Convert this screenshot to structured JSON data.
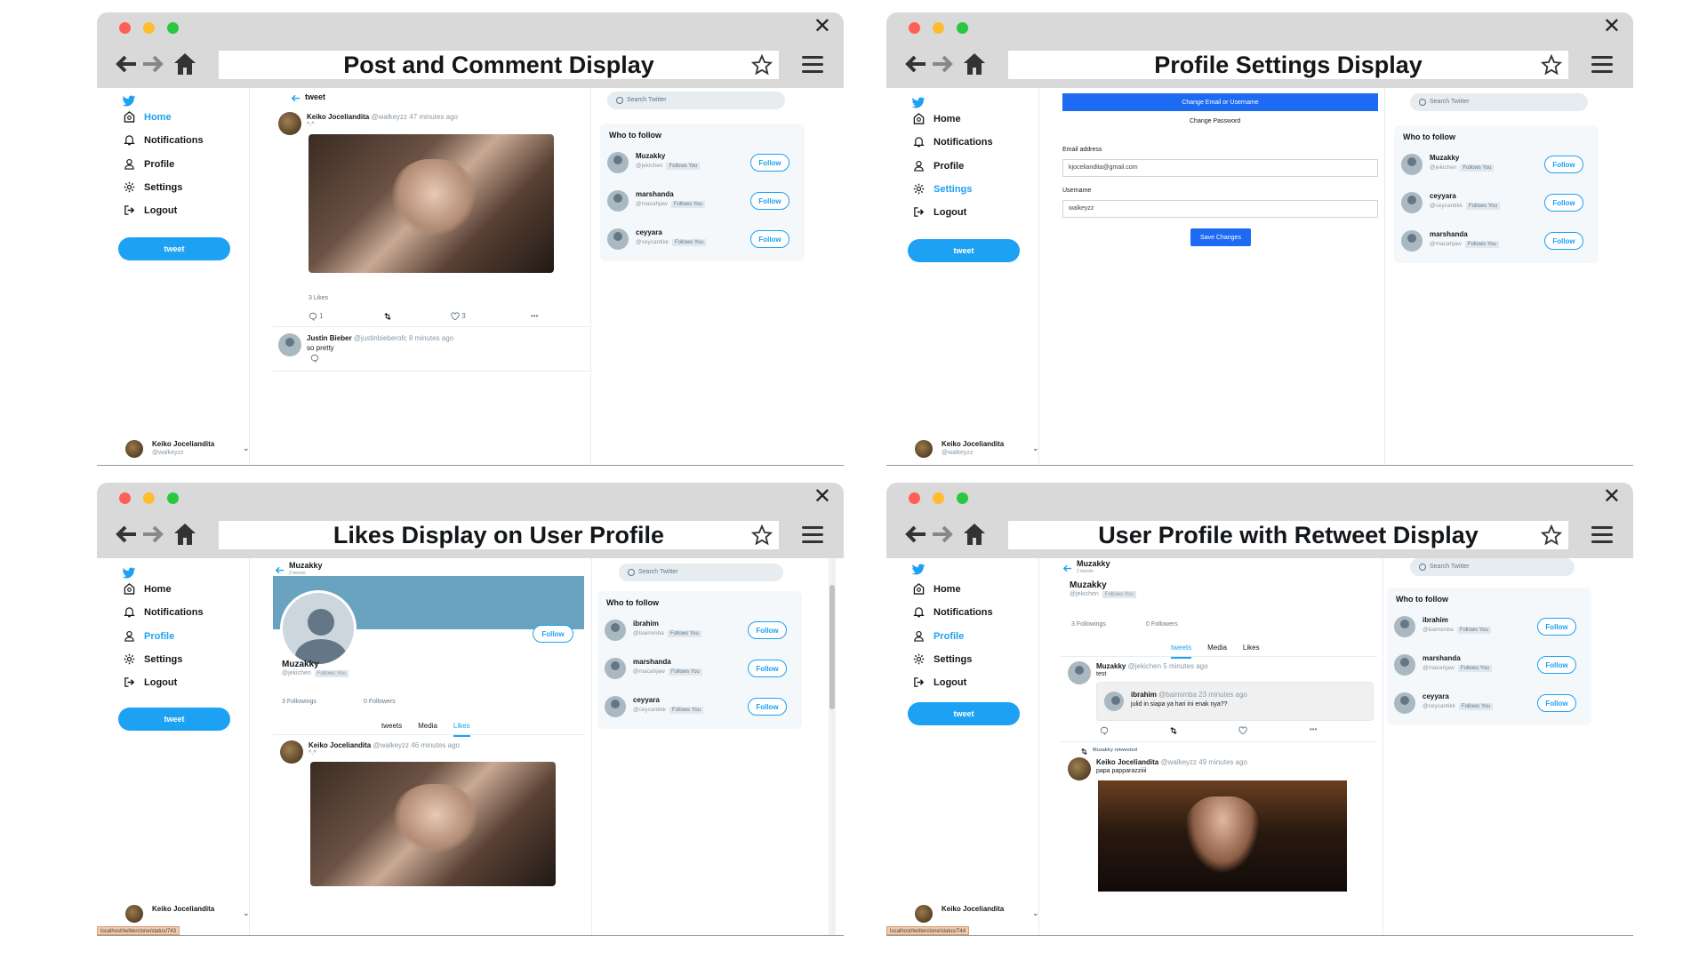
{
  "windows": [
    {
      "title": "Post and Comment Display"
    },
    {
      "title": "Profile Settings Display"
    },
    {
      "title": "Likes Display on User Profile"
    },
    {
      "title": "User Profile with Retweet Display"
    }
  ],
  "nav": {
    "home": "Home",
    "notifications": "Notifications",
    "profile": "Profile",
    "settings": "Settings",
    "logout": "Logout",
    "tweet_button": "tweet"
  },
  "account": {
    "name": "Keiko Joceliandita",
    "handle": "@walkeyzz"
  },
  "search_placeholder": "Search Twitter",
  "who_to_follow": "Who to follow",
  "follow_label": "Follow",
  "follows_you": "Follows You",
  "w1": {
    "header": "tweet",
    "post_author": "Keiko Joceliandita",
    "post_meta": "@walkeyzz 47 minutes ago",
    "post_text": "^.^",
    "likes": "3 Likes",
    "reply_count": "1",
    "like_count": "3",
    "more": "•••",
    "comment_author": "Justin Bieber",
    "comment_meta": "@justinbieberofc 8 minutes ago",
    "comment_text": "so pretty",
    "follow": [
      {
        "name": "Muzakky",
        "handle": "@jekichen"
      },
      {
        "name": "marshanda",
        "handle": "@macahjaw"
      },
      {
        "name": "ceyyara",
        "handle": "@ceycantikk"
      }
    ]
  },
  "w2": {
    "change_email_btn": "Change Email or Username",
    "change_password": "Change Password",
    "email_label": "Email address",
    "email_value": "kjoceliandita@gmail.com",
    "username_label": "Username",
    "username_value": "walkeyzz",
    "save_btn": "Save Changes",
    "follow": [
      {
        "name": "Muzakky",
        "handle": "@jekichen"
      },
      {
        "name": "ceyyara",
        "handle": "@ceycantikk"
      },
      {
        "name": "marshanda",
        "handle": "@macahjaw"
      }
    ]
  },
  "w3": {
    "profile_name": "Muzakky",
    "tweets_count": "2 tweets",
    "handle": "@jekichen",
    "followings": "3 Followings",
    "followers": "0 Followers",
    "tabs": [
      "tweets",
      "Media",
      "Likes"
    ],
    "post_author": "Keiko Joceliandita",
    "post_meta": "@walkeyzz 46 minutes ago",
    "post_text": "^.^",
    "status_url": "localhost/twitterclone/status/743",
    "follow": [
      {
        "name": "ibrahim",
        "handle": "@baimimba"
      },
      {
        "name": "marshanda",
        "handle": "@macahjaw"
      },
      {
        "name": "ceyyara",
        "handle": "@ceycantikk"
      }
    ]
  },
  "w4": {
    "profile_name": "Muzakky",
    "tweets_count": "2 tweets",
    "handle": "@jekichen",
    "followings": "3 Followings",
    "followers": "0 Followers",
    "tabs": [
      "tweets",
      "Media",
      "Likes"
    ],
    "t1_author": "Muzakky",
    "t1_meta": "@jekichen 5 minutes ago",
    "t1_text": "test",
    "q_author": "ibrahim",
    "q_meta": "@baimimba 23 minutes ago",
    "q_text": "julid in siapa ya hari ini enak nya??",
    "retweeted": "Muzakky retweeted",
    "t2_author": "Keiko Joceliandita",
    "t2_meta": "@walkeyzz 49 minutes ago",
    "t2_text": "papa papparazziiii",
    "status_url": "localhost/twitterclone/status/744",
    "follow": [
      {
        "name": "ibrahim",
        "handle": "@baimimba"
      },
      {
        "name": "marshanda",
        "handle": "@macahjaw"
      },
      {
        "name": "ceyyara",
        "handle": "@ceycantikk"
      }
    ]
  }
}
